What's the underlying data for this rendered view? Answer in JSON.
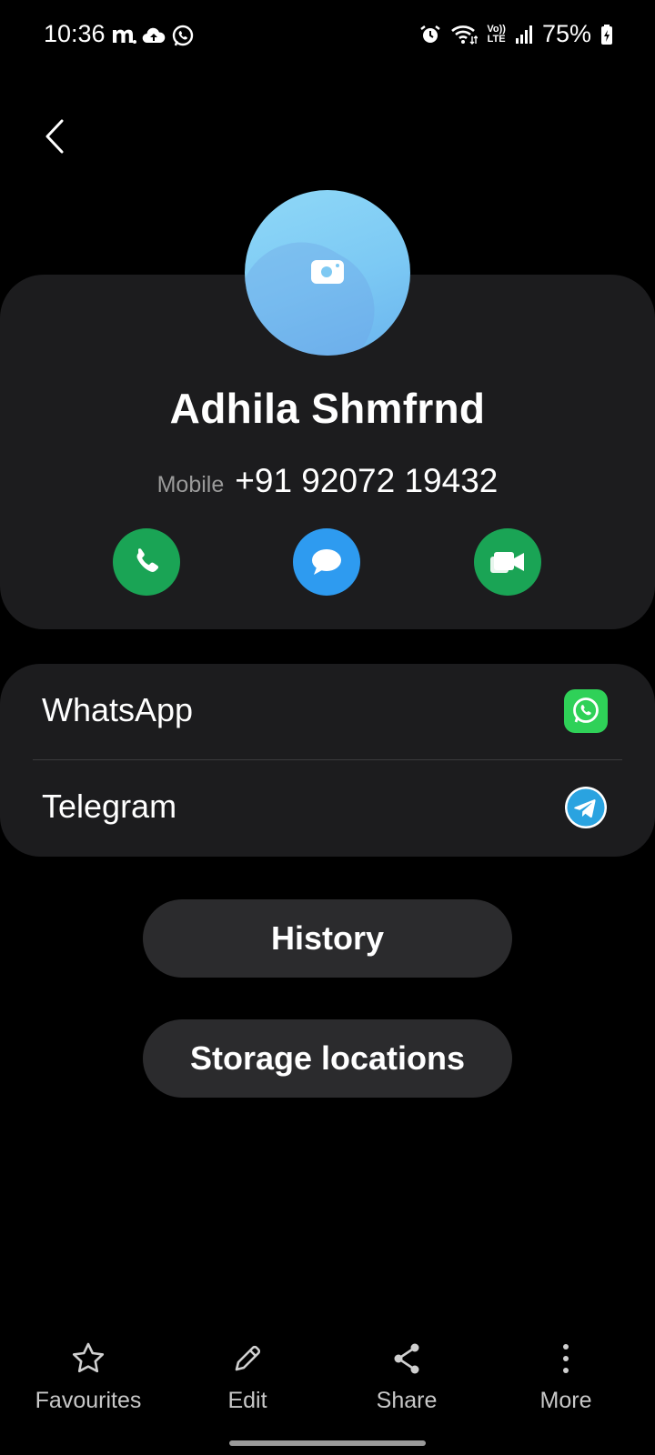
{
  "status_bar": {
    "time": "10:36",
    "battery": "75%",
    "icons": [
      "m-icon",
      "cloud-sync-icon",
      "whatsapp-icon",
      "alarm-icon",
      "wifi-icon",
      "volte-icon",
      "signal-icon",
      "battery-charging-icon"
    ],
    "volte_text_top": "Vo))",
    "volte_text_bottom": "LTE"
  },
  "contact": {
    "name": "Adhila Shmfrnd",
    "phone_type": "Mobile",
    "phone_number": "+91 92072 19432"
  },
  "apps": [
    {
      "label": "WhatsApp",
      "icon": "whatsapp-icon",
      "color": "#2fd158"
    },
    {
      "label": "Telegram",
      "icon": "telegram-icon",
      "color": "#2aa3e0"
    }
  ],
  "buttons": {
    "history": "History",
    "storage": "Storage locations"
  },
  "bottom_bar": [
    {
      "label": "Favourites",
      "icon": "star-icon"
    },
    {
      "label": "Edit",
      "icon": "pencil-icon"
    },
    {
      "label": "Share",
      "icon": "share-icon"
    },
    {
      "label": "More",
      "icon": "more-vertical-icon"
    }
  ],
  "colors": {
    "background": "#000000",
    "card": "#1c1c1e",
    "call_green": "#1aa455",
    "message_blue": "#2e9bf0",
    "pill": "#2b2b2d"
  }
}
